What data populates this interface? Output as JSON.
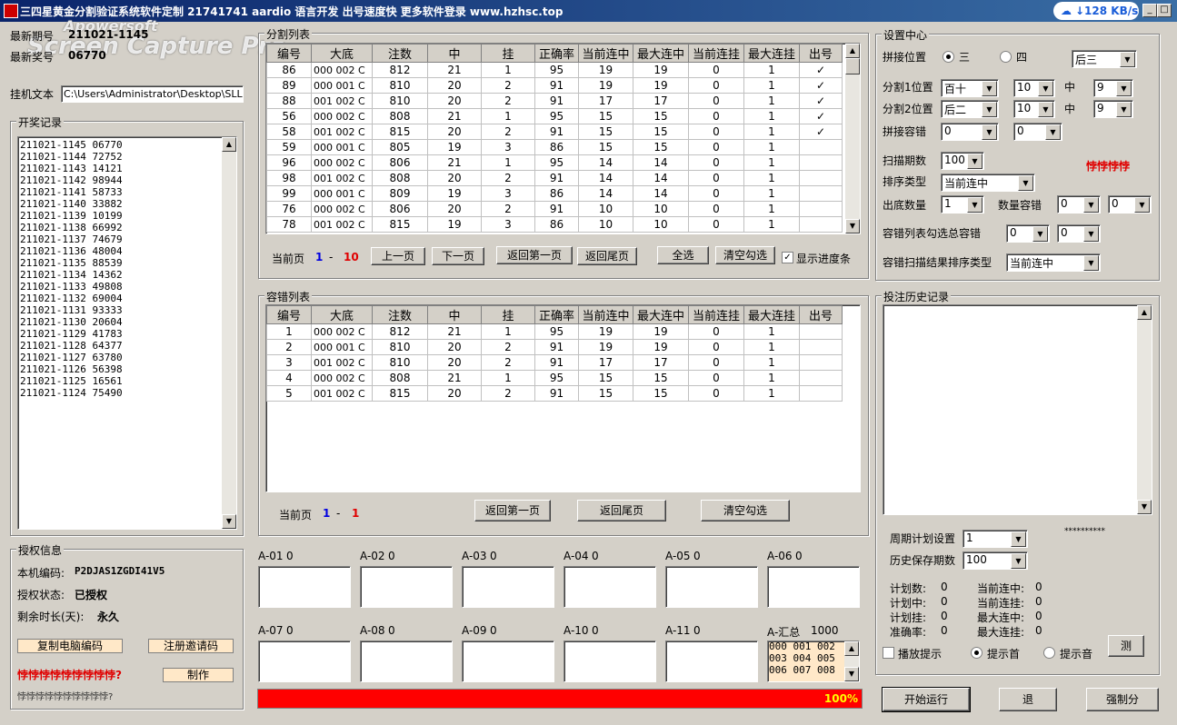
{
  "window": {
    "title": "三四星黄金分割验证系统软件定制 21741741 aardio 语言开发 出号速度快 更多软件登录 www.hzhsc.top",
    "net_speed": "↓128 KB/s",
    "watermark_line1": "Apowersoft",
    "watermark_line2": "Screen Capture Pro"
  },
  "top_info": {
    "latest_period_label": "最新期号",
    "latest_period_value": "211021-1145",
    "latest_number_label": "最新奖号",
    "latest_number_value": "06770",
    "mount_label": "挂机文本",
    "mount_path": "C:\\Users\\Administrator\\Desktop\\SLLFFC"
  },
  "draw_records": {
    "title": "开奖记录",
    "items": [
      "211021-1145 06770",
      "211021-1144 72752",
      "211021-1143 14121",
      "211021-1142 98944",
      "211021-1141 58733",
      "211021-1140 33882",
      "211021-1139 10199",
      "211021-1138 66992",
      "211021-1137 74679",
      "211021-1136 48004",
      "211021-1135 88539",
      "211021-1134 14362",
      "211021-1133 49808",
      "211021-1132 69004",
      "211021-1131 93333",
      "211021-1130 20604",
      "211021-1129 41783",
      "211021-1128 64377",
      "211021-1127 63780",
      "211021-1126 56398",
      "211021-1125 16561",
      "211021-1124 75490"
    ]
  },
  "auth": {
    "title": "授权信息",
    "machine_label": "本机编码:",
    "machine_value": "P2DJAS1ZGDI41V5",
    "status_label": "授权状态:",
    "status_value": "已授权",
    "remain_label": "剩余时长(天):",
    "remain_value": "永久",
    "copy_btn": "复制电脑编码",
    "register_btn": "注册邀请码",
    "red_text": "悖悖悖悖悖悖悖悖悖?",
    "make_btn": "制作",
    "gray_text": "悖悖悖悖悖悖悖悖悖悖?"
  },
  "split_list": {
    "title": "分割列表",
    "headers": [
      "编号",
      "大底",
      "注数",
      "中",
      "挂",
      "正确率",
      "当前连中",
      "最大连中",
      "当前连挂",
      "最大连挂",
      "出号"
    ],
    "rows": [
      [
        "86",
        "000 002 C",
        "812",
        "21",
        "1",
        "95",
        "19",
        "19",
        "0",
        "1",
        "✓"
      ],
      [
        "89",
        "000 001 C",
        "810",
        "20",
        "2",
        "91",
        "19",
        "19",
        "0",
        "1",
        "✓"
      ],
      [
        "88",
        "001 002 C",
        "810",
        "20",
        "2",
        "91",
        "17",
        "17",
        "0",
        "1",
        "✓"
      ],
      [
        "56",
        "000 002 C",
        "808",
        "21",
        "1",
        "95",
        "15",
        "15",
        "0",
        "1",
        "✓"
      ],
      [
        "58",
        "001 002 C",
        "815",
        "20",
        "2",
        "91",
        "15",
        "15",
        "0",
        "1",
        "✓"
      ],
      [
        "59",
        "000 001 C",
        "805",
        "19",
        "3",
        "86",
        "15",
        "15",
        "0",
        "1",
        ""
      ],
      [
        "96",
        "000 002 C",
        "806",
        "21",
        "1",
        "95",
        "14",
        "14",
        "0",
        "1",
        ""
      ],
      [
        "98",
        "001 002 C",
        "808",
        "20",
        "2",
        "91",
        "14",
        "14",
        "0",
        "1",
        ""
      ],
      [
        "99",
        "000 001 C",
        "809",
        "19",
        "3",
        "86",
        "14",
        "14",
        "0",
        "1",
        ""
      ],
      [
        "76",
        "000 002 C",
        "806",
        "20",
        "2",
        "91",
        "10",
        "10",
        "0",
        "1",
        ""
      ],
      [
        "78",
        "001 002 C",
        "815",
        "19",
        "3",
        "86",
        "10",
        "10",
        "0",
        "1",
        ""
      ]
    ],
    "page_label": "当前页",
    "page_from": "1",
    "page_sep": "-",
    "page_to": "10",
    "prev_btn": "上一页",
    "next_btn": "下一页",
    "first_btn": "返回第一页",
    "last_btn": "返回尾页",
    "select_all_btn": "全选",
    "clear_btn": "清空勾选",
    "progress_label": "显示进度条"
  },
  "tolerance_list": {
    "title": "容错列表",
    "headers": [
      "编号",
      "大底",
      "注数",
      "中",
      "挂",
      "正确率",
      "当前连中",
      "最大连中",
      "当前连挂",
      "最大连挂",
      "出号"
    ],
    "rows": [
      [
        "1",
        "000 002 C",
        "812",
        "21",
        "1",
        "95",
        "19",
        "19",
        "0",
        "1",
        ""
      ],
      [
        "2",
        "000 001 C",
        "810",
        "20",
        "2",
        "91",
        "19",
        "19",
        "0",
        "1",
        ""
      ],
      [
        "3",
        "001 002 C",
        "810",
        "20",
        "2",
        "91",
        "17",
        "17",
        "0",
        "1",
        ""
      ],
      [
        "4",
        "000 002 C",
        "808",
        "21",
        "1",
        "95",
        "15",
        "15",
        "0",
        "1",
        ""
      ],
      [
        "5",
        "001 002 C",
        "815",
        "20",
        "2",
        "91",
        "15",
        "15",
        "0",
        "1",
        ""
      ]
    ],
    "page_label": "当前页",
    "page_from": "1",
    "page_sep": "-",
    "page_to": "1",
    "first_btn": "返回第一页",
    "last_btn": "返回尾页",
    "clear_btn": "清空勾选"
  },
  "a_boxes": [
    {
      "label": "A-01",
      "value": "0"
    },
    {
      "label": "A-02",
      "value": "0"
    },
    {
      "label": "A-03",
      "value": "0"
    },
    {
      "label": "A-04",
      "value": "0"
    },
    {
      "label": "A-05",
      "value": "0"
    },
    {
      "label": "A-06",
      "value": "0"
    },
    {
      "label": "A-07",
      "value": "0"
    },
    {
      "label": "A-08",
      "value": "0"
    },
    {
      "label": "A-09",
      "value": "0"
    },
    {
      "label": "A-10",
      "value": "0"
    },
    {
      "label": "A-11",
      "value": "0"
    },
    {
      "label": "A-汇总",
      "value": "1000"
    }
  ],
  "summary_lines": [
    "000 001 002",
    "003 004 005",
    "006 007 008"
  ],
  "progress": {
    "text": "100%",
    "fraction": 1.0
  },
  "settings": {
    "title": "设置中心",
    "join_pos_label": "拼接位置",
    "opt_three": "三",
    "opt_four": "四",
    "join_combo": "后三",
    "split1_label": "分割1位置",
    "split1_combo": "百十",
    "split1_num": "10",
    "split1_mid": "中",
    "split1_num2": "9",
    "split2_label": "分割2位置",
    "split2_combo": "后二",
    "split2_num": "10",
    "split2_mid": "中",
    "split2_num2": "9",
    "join_tol_label": "拼接容错",
    "join_tol_1": "0",
    "join_tol_2": "0",
    "scan_label": "扫描期数",
    "scan_value": "100",
    "red_tag": "悖悖悖悖",
    "sort_label": "排序类型",
    "sort_value": "当前连中",
    "out_count_label": "出底数量",
    "out_count_value": "1",
    "qty_tol_label": "数量容错",
    "qty_tol_1": "0",
    "qty_tol_2": "0",
    "tol_total_label": "容错列表勾选总容错",
    "tol_total_1": "0",
    "tol_total_2": "0",
    "tol_sort_label": "容错扫描结果排序类型",
    "tol_sort_value": "当前连中"
  },
  "history": {
    "title": "投注历史记录",
    "cycle_label": "周期计划设置",
    "cycle_value": "1",
    "save_label": "历史保存期数",
    "save_value": "100",
    "stars": "**********",
    "stats": [
      {
        "label": "计划数:",
        "value": "0"
      },
      {
        "label": "计划中:",
        "value": "0"
      },
      {
        "label": "计划挂:",
        "value": "0"
      },
      {
        "label": "准确率:",
        "value": "0"
      }
    ],
    "stats2": [
      {
        "label": "当前连中:",
        "value": "0"
      },
      {
        "label": "当前连挂:",
        "value": "0"
      },
      {
        "label": "最大连中:",
        "value": "0"
      },
      {
        "label": "最大连挂:",
        "value": "0"
      }
    ],
    "play_label": "播放提示",
    "tip_first_label": "提示首",
    "tip_sound_label": "提示音",
    "test_btn": "测"
  },
  "bottom_buttons": {
    "start": "开始运行",
    "exit": "退",
    "force": "强制分"
  }
}
